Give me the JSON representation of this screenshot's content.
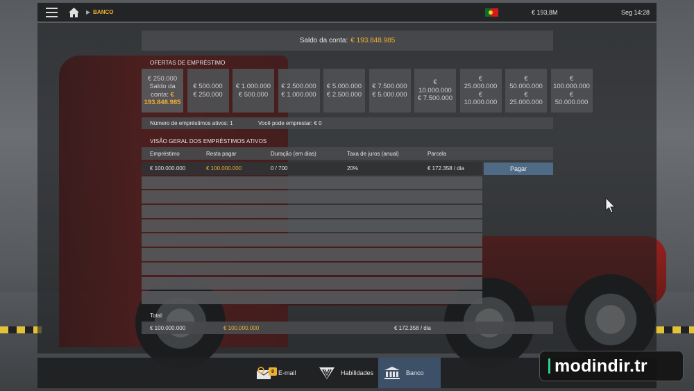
{
  "topbar": {
    "breadcrumb": "BANCO",
    "money": "€ 193,8M",
    "clock": "Seg 14:28"
  },
  "balance": {
    "label": "Saldo da conta:",
    "value": "€ 193.848.985"
  },
  "offers": {
    "title": "OFERTAS DE EMPRÉSTIMO",
    "first": {
      "line1": "€ 250.000",
      "line2": "Saldo da",
      "line3": "conta:",
      "line4": "€",
      "line5": "193.848.985"
    },
    "items": [
      {
        "l1": "€ 500.000",
        "l2": "€ 250.000"
      },
      {
        "l1": "€ 1.000.000",
        "l2": "€ 500.000"
      },
      {
        "l1": "€ 2.500.000",
        "l2": "€ 1.000.000"
      },
      {
        "l1": "€ 5.000.000",
        "l2": "€ 2.500.000"
      },
      {
        "l1": "€ 7.500.000",
        "l2": "€ 5.000.000"
      },
      {
        "l1": "€",
        "l2": "10.000.000",
        "l3": "€ 7.500.000"
      },
      {
        "l1": "€",
        "l2": "25.000.000",
        "l3": "€",
        "l4": "10.000.000"
      },
      {
        "l1": "€",
        "l2": "50.000.000",
        "l3": "€",
        "l4": "25.000.000"
      },
      {
        "l1": "€",
        "l2": "100.000.000",
        "l3": "€",
        "l4": "50.000.000"
      }
    ]
  },
  "info": {
    "active_loans": "Número de empréstimos ativos: 1",
    "can_borrow": "Você pode emprestar: € 0"
  },
  "overview": {
    "title": "VISÃO GERAL DOS EMPRÉSTIMOS ATIVOS",
    "headers": [
      "Empréstimo",
      "Resta pagar",
      "Duração (em dias)",
      "Taxa de juros (anual)",
      "Parcela"
    ],
    "loans": [
      {
        "amount": "€ 100.000.000",
        "remaining": "€ 100.000.000",
        "duration": "0 / 700",
        "rate": "20%",
        "installment": "€ 172.358 / dia"
      }
    ],
    "pay_label": "Pagar"
  },
  "totals": {
    "label": "Total:",
    "amount": "€ 100.000.000",
    "remaining": "€ 100.000.000",
    "installment": "€ 172.358 / dia"
  },
  "bottom_tabs": {
    "email": "E-mail",
    "email_badge": "8",
    "skills": "Habilidades",
    "bank": "Banco"
  },
  "watermark": "modindir.tr",
  "colors": {
    "accent": "#f0b030",
    "active_tab": "#3c5168",
    "pay_button": "#4e6a84"
  }
}
